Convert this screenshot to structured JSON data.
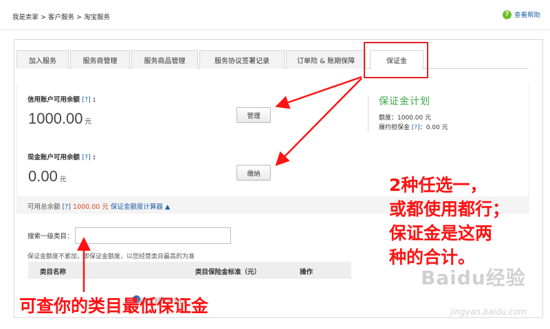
{
  "breadcrumb": "我是卖家 > 客户服务 > 淘宝服务",
  "help_label": "查看帮助",
  "help_icon": "question-circle-icon",
  "tabs": [
    {
      "label": "加入服务"
    },
    {
      "label": "服务商管理"
    },
    {
      "label": "服务商品管理"
    },
    {
      "label": "服务协议签署记录"
    },
    {
      "label": "订单险 & 账期保障"
    },
    {
      "label": "保证金"
    }
  ],
  "active_tab": "保证金",
  "credit": {
    "label": "信用账户可用余额",
    "help": "[?]",
    "colon": ":",
    "amount": "1000.00",
    "unit": "元",
    "button": "管理"
  },
  "cash": {
    "label": "现金账户可用余额",
    "help": "[?]",
    "colon": ":",
    "amount": "0.00",
    "unit": "元",
    "button": "缴纳"
  },
  "plan": {
    "title": "保证金计划",
    "quota": "额度：1000.00 元",
    "performance_prefix": "履约担保金",
    "performance_help": "[?]",
    "performance_value": "：0.00 元"
  },
  "total": {
    "label": "可用总余额",
    "help": "[?]",
    "amount": "1000.00 元",
    "calculator": "保证金额度计算器",
    "toggle_icon": "triangle-up-icon"
  },
  "search": {
    "label": "搜索一级类目：",
    "value": "",
    "placeholder": ""
  },
  "note": "保证金额度不累加，即保证金额度，以您经营类目最高的为准",
  "table": {
    "columns": [
      "类目名称",
      "类目保险金标准（元）",
      "操作"
    ],
    "partial_text": "搜索您经营的类目"
  },
  "annotations": {
    "right_lines": [
      "2种任选一，",
      "或都使用都行；",
      "保证金是这两",
      "种的合计。"
    ],
    "bottom": "可查你的类目最低保证金"
  },
  "watermark": {
    "logo": "Baidu经验",
    "url": "jingyan.baidu.com"
  },
  "colors": {
    "annotation_red": "#ff1212",
    "link_blue": "#1f5fa8",
    "amount_red": "#d64b1f",
    "plan_green": "#3aa845",
    "help_green": "#6cbf2a"
  }
}
